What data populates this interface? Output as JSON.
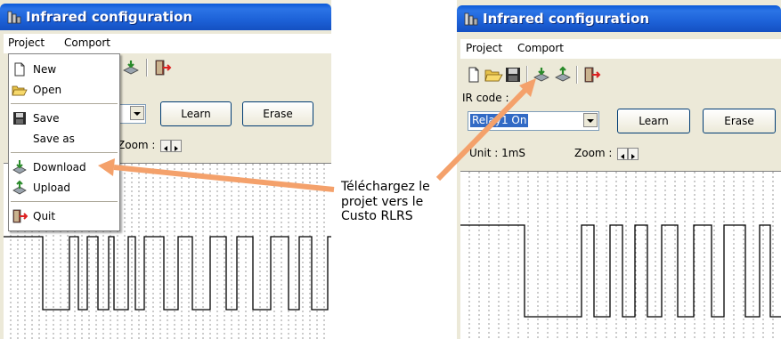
{
  "left_window": {
    "title": "Infrared configuration",
    "menu": {
      "project": "Project",
      "comport": "Comport"
    },
    "dropdown": {
      "new": "New",
      "open": "Open",
      "save": "Save",
      "save_as": "Save as",
      "download": "Download",
      "upload": "Upload",
      "quit": "Quit"
    },
    "learn_button": "Learn",
    "erase_button": "Erase",
    "zoom_label": "Zoom :"
  },
  "right_window": {
    "title": "Infrared configuration",
    "menu": {
      "project": "Project",
      "comport": "Comport"
    },
    "ir_code_label": "IR code :",
    "ir_code_value": "Relay1 On",
    "learn_button": "Learn",
    "erase_button": "Erase",
    "unit_label": "Unit : 1mS",
    "zoom_label": "Zoom :"
  },
  "annotation": {
    "lines": [
      "Téléchargez le",
      "projet vers le",
      "Custo RLRS"
    ]
  },
  "colors": {
    "titlebar": "#2b74e6",
    "arrow": "#f4a16b",
    "selection": "#316ac5",
    "window_bg": "#ece9d8"
  }
}
